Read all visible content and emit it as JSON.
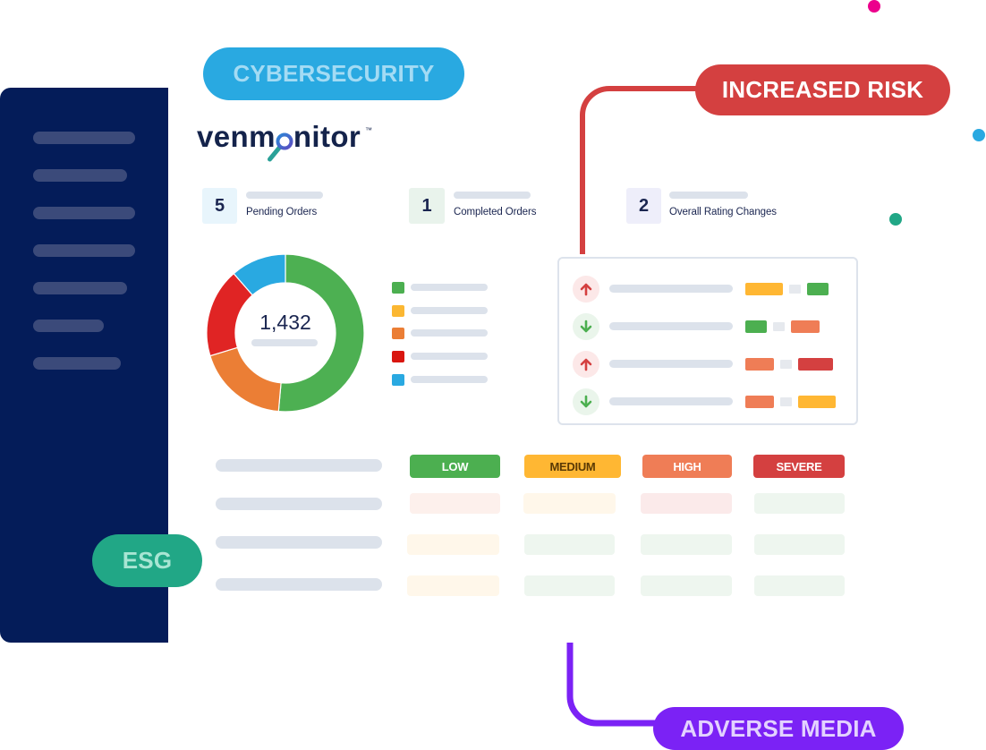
{
  "theme": {
    "sidebar_bg": "#041C59"
  },
  "tags": {
    "cybersecurity": {
      "label": "CYBERSECURITY",
      "bg": "#29A9E1",
      "fg": "#A3DBF4"
    },
    "increased_risk": {
      "label": "INCREASED RISK",
      "bg": "#D44040",
      "fg": "#FFFFFF"
    },
    "esg": {
      "label": "ESG",
      "bg": "#21A786",
      "fg": "#A8E5D3"
    },
    "adverse_media": {
      "label": "ADVERSE MEDIA",
      "bg": "#7B22F5",
      "fg": "#E3D2FF"
    }
  },
  "decor_dots": [
    {
      "color": "#EC008C"
    },
    {
      "color": "#29A9E1"
    },
    {
      "color": "#21A786"
    }
  ],
  "brand": {
    "name_before": "venm",
    "name_after": "nitor",
    "trademark": "™",
    "color": "#14234B"
  },
  "stats": [
    {
      "value": "5",
      "label": "Pending Orders",
      "bg": "#E8F5FC"
    },
    {
      "value": "1",
      "label": "Completed Orders",
      "bg": "#E9F3EC"
    },
    {
      "value": "2",
      "label": "Overall Rating Changes",
      "bg": "#EEEEFA"
    }
  ],
  "legend": {
    "items": [
      {
        "color": "#4CAF50"
      },
      {
        "color": "#FBB732"
      },
      {
        "color": "#EB7E35"
      },
      {
        "color": "#D9160F"
      },
      {
        "color": "#29A9E1"
      }
    ]
  },
  "levels": {
    "low": {
      "label": "LOW",
      "color": "#4CAF50",
      "text": "#FFFFFF",
      "tint": "#EEF6EF"
    },
    "medium": {
      "label": "MEDIUM",
      "color": "#FFB733",
      "text": "#5A3A05",
      "tint": "#FFF7EA"
    },
    "high": {
      "label": "HIGH",
      "color": "#EF7D56",
      "text": "#FFFFFF",
      "tint": "#FDF0EC"
    },
    "severe": {
      "label": "SEVERE",
      "color": "#D44040",
      "text": "#FFFFFF",
      "tint": "#FBEAEA"
    }
  },
  "rating_changes": {
    "rows": [
      {
        "direction": "up",
        "from": "medium",
        "to": "low"
      },
      {
        "direction": "down",
        "from": "low",
        "to": "high"
      },
      {
        "direction": "up",
        "from": "high",
        "to": "severe"
      },
      {
        "direction": "down",
        "from": "high",
        "to": "medium"
      }
    ]
  },
  "severity_matrix": {
    "columns": [
      "low",
      "medium",
      "high",
      "severe"
    ],
    "rows": [
      [
        "high",
        "medium",
        "severe",
        "low"
      ],
      [
        "medium",
        "low",
        "low",
        "low"
      ],
      [
        "medium",
        "low",
        "low",
        "low"
      ]
    ]
  },
  "chart_data": {
    "type": "pie",
    "variant": "donut",
    "title": "",
    "center_label": "1,432",
    "values": [
      51.4,
      18.9,
      18.3,
      11.4
    ],
    "unit": "percent (estimated)",
    "colors": [
      "#4DB052",
      "#EB7E35",
      "#E02424",
      "#29A9E1"
    ],
    "start": "top",
    "direction": "clockwise"
  }
}
